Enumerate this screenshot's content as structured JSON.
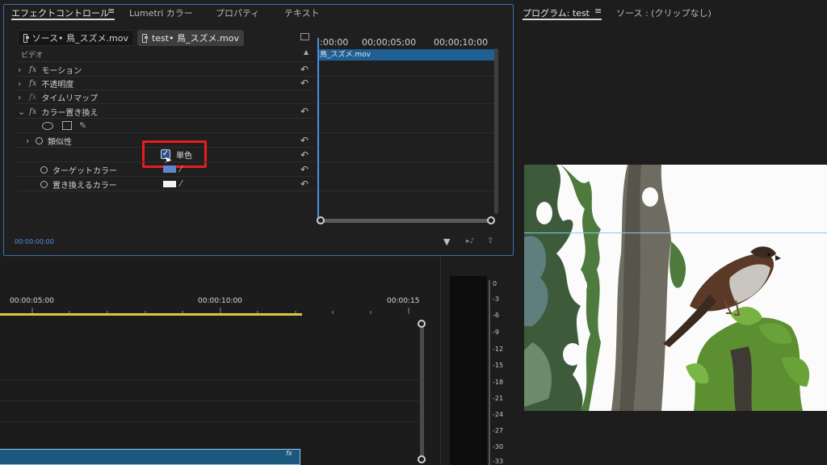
{
  "effect_controls": {
    "tabs": [
      "エフェクトコントロール",
      "Lumetri カラー",
      "プロパティ",
      "テキスト"
    ],
    "tab_menu_icon": "≡",
    "source_tab": "ソース• 鳥_スズメ.mov",
    "sequence_tab": "test• 鳥_スズメ.mov",
    "section_header": "ビデオ",
    "effects": [
      {
        "label": "モーション"
      },
      {
        "label": "不透明度"
      },
      {
        "label": "タイムリマップ"
      },
      {
        "label": "カラー置き換え"
      }
    ],
    "properties": {
      "similarity": "類似性",
      "solid_colors": "単色",
      "solid_checked": true,
      "target_color": "ターゲットカラー",
      "replace_color": "置き換えるカラー"
    },
    "timecode": "00:00:00:00",
    "mini_timeline": {
      "ruler": [
        ":00:00",
        "00;00;05;00",
        "00;00;10;00"
      ],
      "clip_name": "鳥_スズメ.mov"
    },
    "colors": {
      "target": "#5e86c8",
      "replace": "#f4f4f4",
      "highlight": "#e81d1d",
      "focus": "#3b6fb4"
    }
  },
  "program_monitor": {
    "tab": "プログラム: test",
    "menu_icon": "≡",
    "source_tab": "ソース : (クリップなし)"
  },
  "timeline": {
    "times": [
      "00:00:05:00",
      "00:00:10:00",
      "00:00:15"
    ],
    "clip_badge": "fx"
  },
  "audio_meter": {
    "scale": [
      "0",
      "-3",
      "-6",
      "-9",
      "-12",
      "-15",
      "-18",
      "-21",
      "-24",
      "-27",
      "-30",
      "-33"
    ]
  }
}
